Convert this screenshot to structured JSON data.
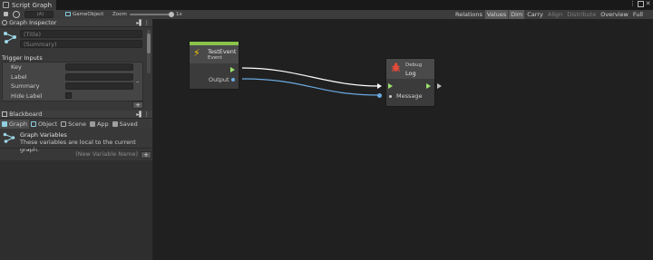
{
  "window": {
    "tab_title": "Script Graph",
    "menu_icon": "more-vert-icon",
    "maximize_icon": "square-icon",
    "close_icon": "close-icon"
  },
  "toolbar": {
    "object_field": "(A)",
    "target_label": "GameObject",
    "zoom_label": "Zoom",
    "zoom_value": "1x",
    "buttons": [
      {
        "label": "Relations",
        "active": false
      },
      {
        "label": "Values",
        "active": true
      },
      {
        "label": "Dim",
        "active": true
      },
      {
        "label": "Carry",
        "active": false
      },
      {
        "label": "Align ▾",
        "active": false,
        "disabled": true
      },
      {
        "label": "Distribute ▾",
        "active": false,
        "disabled": true
      },
      {
        "label": "Overview",
        "active": false
      },
      {
        "label": "Full Screen",
        "active": false
      }
    ]
  },
  "inspector": {
    "header": "Graph Inspector",
    "title_placeholder": "(Title)",
    "summary_placeholder": "(Summary)",
    "trigger_inputs": {
      "header": "Trigger Inputs",
      "rows": [
        "Key",
        "Label",
        "Summary",
        "Hide Label"
      ],
      "remove_label": "–",
      "add_label": "+"
    }
  },
  "blackboard": {
    "header": "Blackboard",
    "tabs": [
      {
        "label": "Graph",
        "icon": "graph-icon",
        "active": true
      },
      {
        "label": "Object",
        "icon": "object-icon",
        "active": false
      },
      {
        "label": "Scene",
        "icon": "scene-icon",
        "active": false
      },
      {
        "label": "App",
        "icon": "app-icon",
        "active": false
      },
      {
        "label": "Saved",
        "icon": "saved-icon",
        "active": false
      }
    ],
    "variables_title": "Graph Variables",
    "variables_desc": "These variables are local to the current graph.",
    "new_var_placeholder": "(New Variable Name)",
    "add_label": "+"
  },
  "graph": {
    "event_node": {
      "title": "TestEvent",
      "subtitle": "Event",
      "output_label": "Output",
      "header_color": "#8bc34a"
    },
    "log_node": {
      "category": "Debug",
      "title": "Log",
      "input_label": "Message"
    },
    "colors": {
      "flow": "#ffffff",
      "value": "#6aa9e0",
      "flow_port": "#9be36a"
    }
  }
}
